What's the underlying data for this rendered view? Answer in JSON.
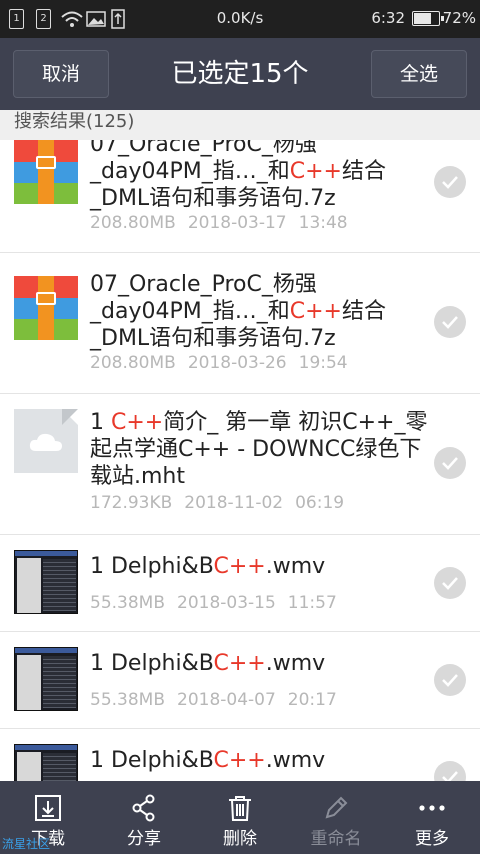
{
  "status_bar": {
    "sim1": "1",
    "sim2": "2",
    "speed": "0.0K/s",
    "time": "6:32",
    "battery_percent": "72%",
    "battery_level": 0.72
  },
  "header": {
    "cancel_label": "取消",
    "title": "已选定15个",
    "select_all_label": "全选"
  },
  "section": {
    "title": "搜索结果(125)"
  },
  "files": [
    {
      "type": "zip",
      "name_parts": [
        "07_Oracle_ProC_杨强_day04PM_指…_和",
        "C++",
        "结合_DML语句和事务语句.7z"
      ],
      "size": "208.80MB",
      "date": "2018-03-17",
      "time": "13:48"
    },
    {
      "type": "zip",
      "name_parts": [
        "07_Oracle_ProC_杨强_day04PM_指…_和",
        "C++",
        "结合_DML语句和事务语句.7z"
      ],
      "size": "208.80MB",
      "date": "2018-03-26",
      "time": "19:54"
    },
    {
      "type": "doc",
      "name_parts": [
        "1 ",
        "C++",
        "简介_ 第一章 初识C++_零起点学通C++ - DOWNCC绿色下载站.mht"
      ],
      "size": "172.93KB",
      "date": "2018-11-02",
      "time": "06:19"
    },
    {
      "type": "video",
      "name_parts": [
        "1 Delphi&B",
        "C++",
        ".wmv"
      ],
      "size": "55.38MB",
      "date": "2018-03-15",
      "time": "11:57"
    },
    {
      "type": "video",
      "name_parts": [
        "1 Delphi&B",
        "C++",
        ".wmv"
      ],
      "size": "55.38MB",
      "date": "2018-04-07",
      "time": "20:17"
    },
    {
      "type": "video",
      "name_parts": [
        "1 Delphi&B",
        "C++",
        ".wmv"
      ],
      "size": "",
      "date": "",
      "time": ""
    }
  ],
  "bottom_bar": {
    "download": {
      "label": "下载",
      "icon": "download-icon"
    },
    "share": {
      "label": "分享",
      "icon": "share-icon"
    },
    "delete": {
      "label": "删除",
      "icon": "trash-icon"
    },
    "rename": {
      "label": "重命名",
      "icon": "pencil-icon",
      "disabled": true
    },
    "more": {
      "label": "更多",
      "icon": "more-dots-icon"
    }
  },
  "watermark": "流星社区",
  "colors": {
    "header_bg": "#3e4150",
    "highlight": "#e8382a",
    "meta_text": "#b7b7b7",
    "disabled_text": "#8a8d98"
  }
}
